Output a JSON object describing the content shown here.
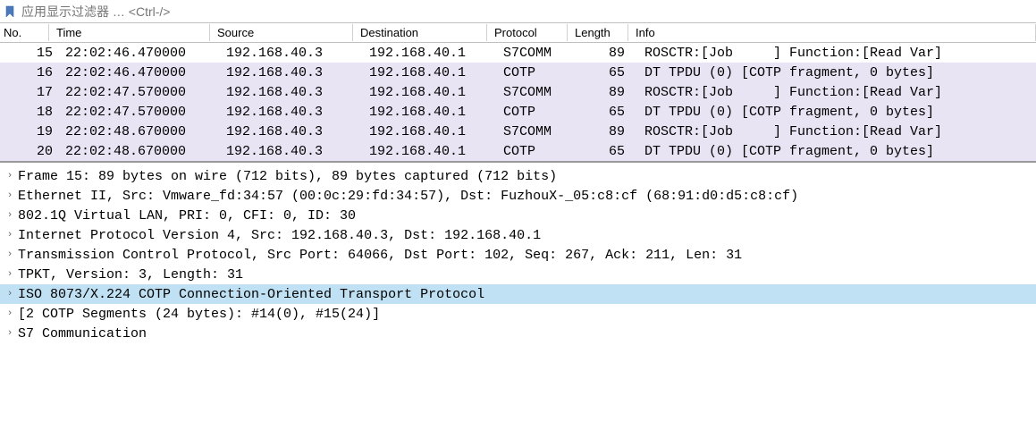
{
  "filter": {
    "placeholder": "应用显示过滤器 … <Ctrl-/>"
  },
  "columns": {
    "no": "No.",
    "time": "Time",
    "source": "Source",
    "destination": "Destination",
    "protocol": "Protocol",
    "length": "Length",
    "info": "Info"
  },
  "packets": [
    {
      "no": "15",
      "time": "22:02:46.470000",
      "src": "192.168.40.3",
      "dst": "192.168.40.1",
      "proto": "S7COMM",
      "len": "89",
      "info": "ROSCTR:[Job     ] Function:[Read Var]",
      "bg": "white"
    },
    {
      "no": "16",
      "time": "22:02:46.470000",
      "src": "192.168.40.3",
      "dst": "192.168.40.1",
      "proto": "COTP",
      "len": "65",
      "info": "DT TPDU (0) [COTP fragment, 0 bytes]",
      "bg": "lavender"
    },
    {
      "no": "17",
      "time": "22:02:47.570000",
      "src": "192.168.40.3",
      "dst": "192.168.40.1",
      "proto": "S7COMM",
      "len": "89",
      "info": "ROSCTR:[Job     ] Function:[Read Var]",
      "bg": "lavender"
    },
    {
      "no": "18",
      "time": "22:02:47.570000",
      "src": "192.168.40.3",
      "dst": "192.168.40.1",
      "proto": "COTP",
      "len": "65",
      "info": "DT TPDU (0) [COTP fragment, 0 bytes]",
      "bg": "lavender"
    },
    {
      "no": "19",
      "time": "22:02:48.670000",
      "src": "192.168.40.3",
      "dst": "192.168.40.1",
      "proto": "S7COMM",
      "len": "89",
      "info": "ROSCTR:[Job     ] Function:[Read Var]",
      "bg": "lavender"
    },
    {
      "no": "20",
      "time": "22:02:48.670000",
      "src": "192.168.40.3",
      "dst": "192.168.40.1",
      "proto": "COTP",
      "len": "65",
      "info": "DT TPDU (0) [COTP fragment, 0 bytes]",
      "bg": "lavender"
    }
  ],
  "details": [
    {
      "text": "Frame 15: 89 bytes on wire (712 bits), 89 bytes captured (712 bits)",
      "highlighted": false
    },
    {
      "text": "Ethernet II, Src: Vmware_fd:34:57 (00:0c:29:fd:34:57), Dst: FuzhouX-_05:c8:cf (68:91:d0:d5:c8:cf)",
      "highlighted": false
    },
    {
      "text": "802.1Q Virtual LAN, PRI: 0, CFI: 0, ID: 30",
      "highlighted": false
    },
    {
      "text": "Internet Protocol Version 4, Src: 192.168.40.3, Dst: 192.168.40.1",
      "highlighted": false
    },
    {
      "text": "Transmission Control Protocol, Src Port: 64066, Dst Port: 102, Seq: 267, Ack: 211, Len: 31",
      "highlighted": false
    },
    {
      "text": "TPKT, Version: 3, Length: 31",
      "highlighted": false
    },
    {
      "text": "ISO 8073/X.224 COTP Connection-Oriented Transport Protocol",
      "highlighted": true
    },
    {
      "text": "[2 COTP Segments (24 bytes): #14(0), #15(24)]",
      "highlighted": false
    },
    {
      "text": "S7 Communication",
      "highlighted": false
    }
  ]
}
